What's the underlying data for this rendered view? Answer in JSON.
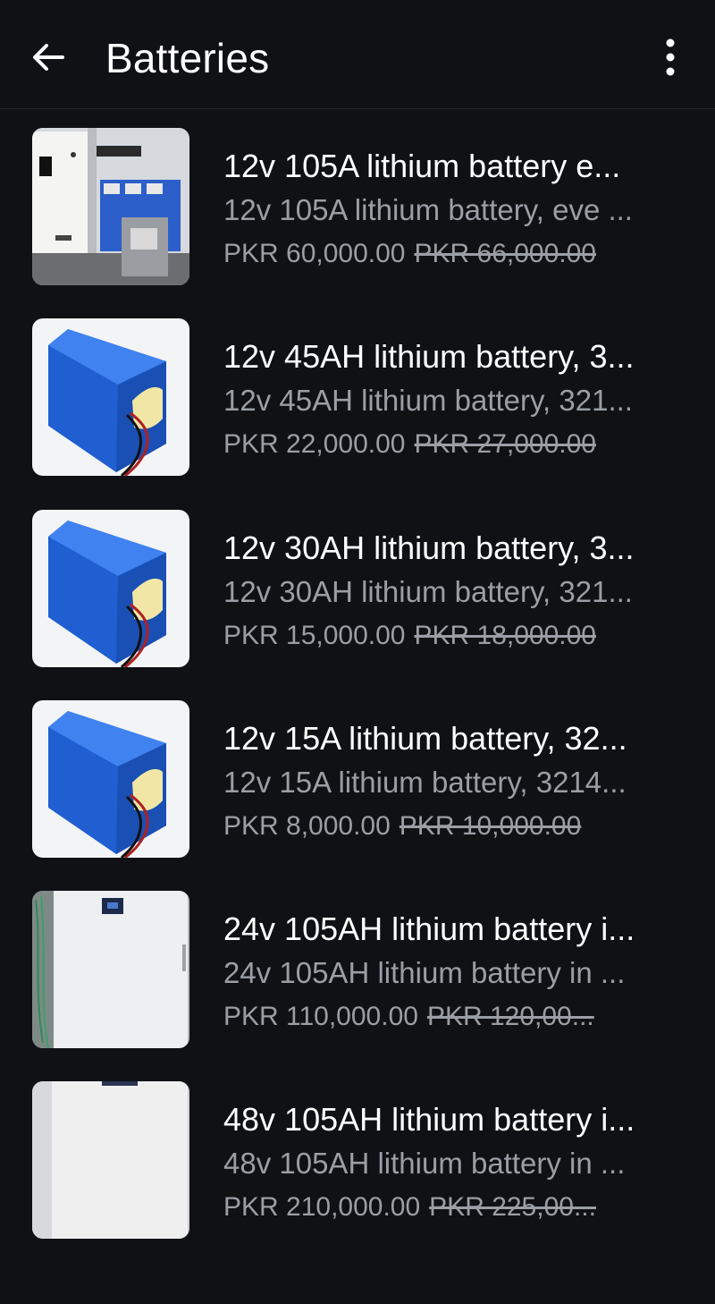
{
  "app_bar": {
    "title": "Batteries",
    "back_icon": "arrow-left-icon",
    "menu_icon": "more-vertical-icon"
  },
  "products": [
    {
      "name": "12v 105A lithium battery e...",
      "description": "12v 105A lithium battery, eve ...",
      "price": "PKR 60,000.00",
      "old_price": "PKR 66,000.00",
      "thumbnail": "wall-battery-cabinet"
    },
    {
      "name": "12v 45AH lithium battery, 3...",
      "description": "12v 45AH lithium battery, 321...",
      "price": "PKR 22,000.00",
      "old_price": "PKR 27,000.00",
      "thumbnail": "blue-battery-pack"
    },
    {
      "name": "12v 30AH lithium battery, 3...",
      "description": "12v 30AH lithium battery, 321...",
      "price": "PKR 15,000.00",
      "old_price": "PKR 18,000.00",
      "thumbnail": "blue-battery-pack"
    },
    {
      "name": "12v 15A lithium battery, 32...",
      "description": "12v 15A lithium battery, 3214...",
      "price": "PKR 8,000.00",
      "old_price": "PKR 10,000.00",
      "thumbnail": "blue-battery-pack"
    },
    {
      "name": "24v 105AH lithium battery i...",
      "description": "24v 105AH lithium battery in ...",
      "price": "PKR 110,000.00",
      "old_price": "PKR 120,00...",
      "thumbnail": "white-battery-cabinet"
    },
    {
      "name": "48v 105AH lithium battery i...",
      "description": "48v 105AH lithium battery in ...",
      "price": "PKR 210,000.00",
      "old_price": "PKR 225,00...",
      "thumbnail": "white-battery-cabinet"
    }
  ],
  "colors": {
    "background": "#0f1114",
    "primary_text": "#ffffff",
    "secondary_text": "#9a9ea5"
  }
}
